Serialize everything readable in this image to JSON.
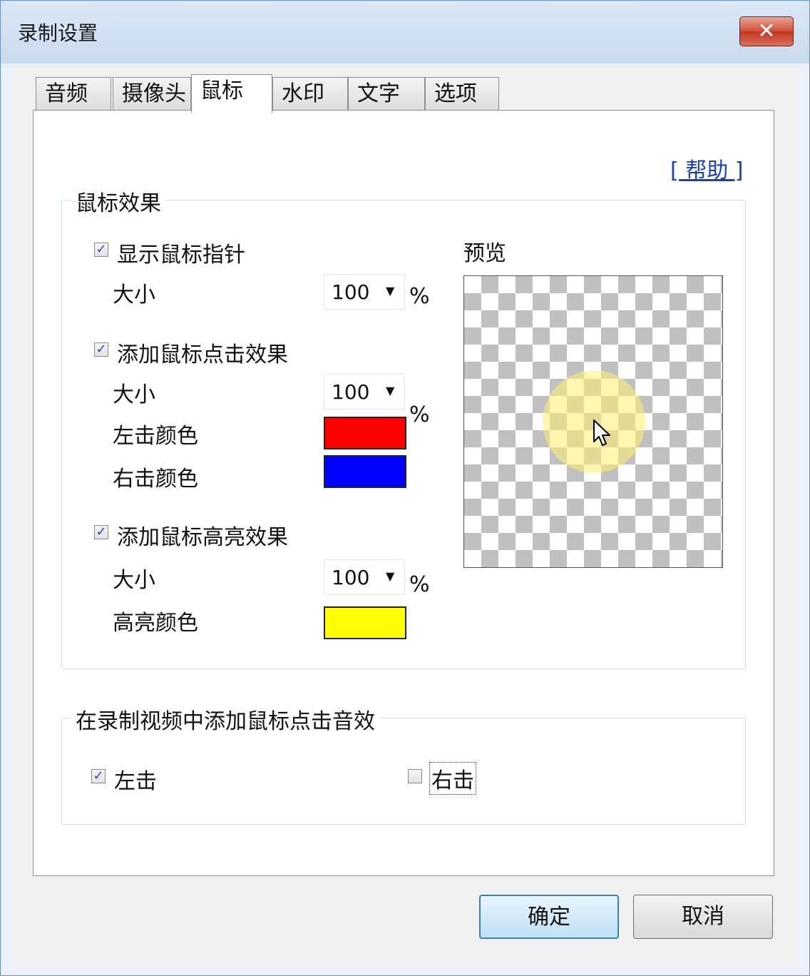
{
  "window": {
    "title": "录制设置",
    "close_icon": "✕"
  },
  "tabs": [
    {
      "label": "音频",
      "active": false
    },
    {
      "label": "摄像头",
      "active": false
    },
    {
      "label": "鼠标",
      "active": true
    },
    {
      "label": "水印",
      "active": false
    },
    {
      "label": "文字",
      "active": false
    },
    {
      "label": "选项",
      "active": false
    }
  ],
  "help_link": "[ 帮助 ]",
  "mouse_effects": {
    "group_title": "鼠标效果",
    "show_pointer": {
      "label": "显示鼠标指针",
      "checked": true,
      "size_label": "大小",
      "size_value": "100",
      "unit": "%"
    },
    "click_effect": {
      "label": "添加鼠标点击效果",
      "checked": true,
      "size_label": "大小",
      "size_value": "100",
      "unit": "%",
      "left_color_label": "左击颜色",
      "left_color": "#ff0000",
      "right_color_label": "右击颜色",
      "right_color": "#0000ff"
    },
    "highlight_effect": {
      "label": "添加鼠标高亮效果",
      "checked": true,
      "size_label": "大小",
      "size_value": "100",
      "unit": "%",
      "color_label": "高亮颜色",
      "color": "#ffff00"
    },
    "preview_label": "预览"
  },
  "click_sound": {
    "group_title": "在录制视频中添加鼠标点击音效",
    "left": {
      "label": "左击",
      "checked": true
    },
    "right": {
      "label": "右击",
      "checked": false
    }
  },
  "buttons": {
    "ok": "确定",
    "cancel": "取消"
  },
  "check_mark": "✓",
  "dropdown_arrow": "▼"
}
